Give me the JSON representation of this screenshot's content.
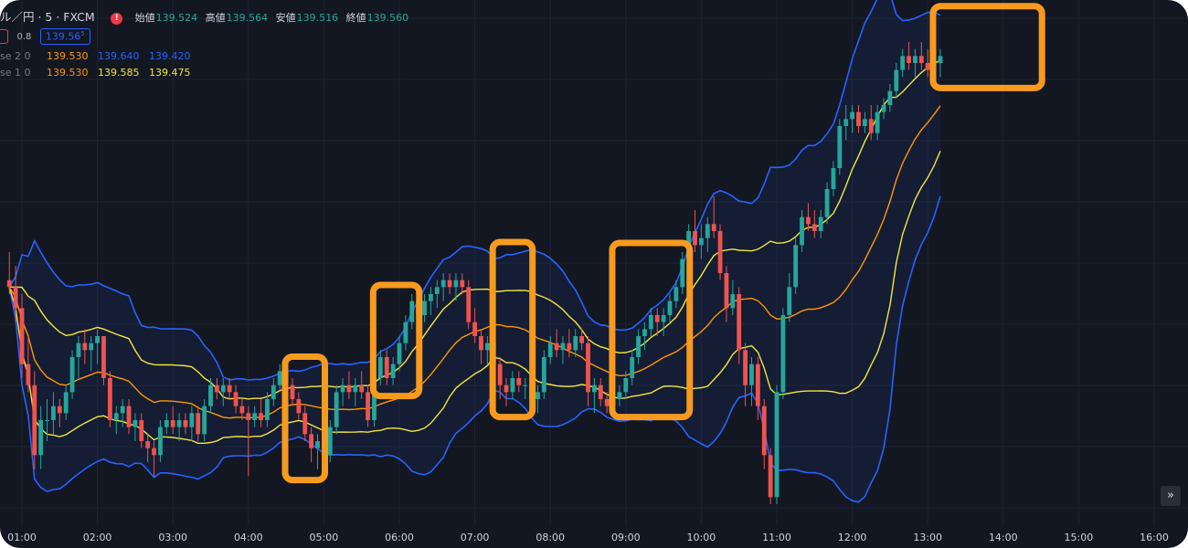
{
  "legend": {
    "symbol": "ル／円 · 5 · FXCM",
    "alert_glyph": "!",
    "ohlc": [
      {
        "label": "始値",
        "value": "139.524"
      },
      {
        "label": "高値",
        "value": "139.564"
      },
      {
        "label": "安値",
        "value": "139.516"
      },
      {
        "label": "終値",
        "value": "139.560"
      }
    ],
    "spread": "0.8",
    "price": "139.56",
    "price_sup": "5",
    "bb20": {
      "label": "se 2 0",
      "basis": "139.530",
      "upper": "139.640",
      "lower": "139.420"
    },
    "bb10": {
      "label": "se 1 0",
      "basis": "139.530",
      "upper": "139.585",
      "lower": "139.475"
    }
  },
  "scroll_glyph": "»",
  "colors": {
    "background": "#131722",
    "up": "#26a69a",
    "down": "#ef5350",
    "bb2_band": "#2962ff",
    "bb1_band": "#f5e53d",
    "basis": "#ff9800",
    "highlight": "#f79a1e"
  },
  "chart_data": {
    "type": "candlestick",
    "x_tick_labels": [
      "01:00",
      "02:00",
      "03:00",
      "04:00",
      "05:00",
      "06:00",
      "07:00",
      "08:00",
      "09:00",
      "10:00",
      "11:00",
      "12:00",
      "13:00",
      "14:00",
      "15:00",
      "16:00"
    ],
    "ylim": [
      139.35,
      140.1
    ],
    "candle_minutes": 5,
    "start_time": "00:50",
    "ohlc": [
      [
        139.7,
        139.74,
        139.68,
        139.69
      ],
      [
        139.69,
        139.72,
        139.64,
        139.66
      ],
      [
        139.66,
        139.68,
        139.56,
        139.58
      ],
      [
        139.58,
        139.62,
        139.54,
        139.55
      ],
      [
        139.55,
        139.57,
        139.43,
        139.45
      ],
      [
        139.45,
        139.52,
        139.43,
        139.5
      ],
      [
        139.5,
        139.53,
        139.47,
        139.5
      ],
      [
        139.5,
        139.54,
        139.48,
        139.52
      ],
      [
        139.52,
        139.53,
        139.49,
        139.51
      ],
      [
        139.51,
        139.55,
        139.5,
        139.54
      ],
      [
        139.54,
        139.6,
        139.53,
        139.59
      ],
      [
        139.59,
        139.62,
        139.56,
        139.61
      ],
      [
        139.61,
        139.63,
        139.58,
        139.6
      ],
      [
        139.6,
        139.62,
        139.57,
        139.61
      ],
      [
        139.61,
        139.63,
        139.58,
        139.62
      ],
      [
        139.62,
        139.62,
        139.55,
        139.56
      ],
      [
        139.56,
        139.57,
        139.49,
        139.5
      ],
      [
        139.5,
        139.52,
        139.48,
        139.51
      ],
      [
        139.51,
        139.53,
        139.49,
        139.52
      ],
      [
        139.52,
        139.53,
        139.48,
        139.49
      ],
      [
        139.49,
        139.51,
        139.47,
        139.5
      ],
      [
        139.5,
        139.51,
        139.46,
        139.47
      ],
      [
        139.47,
        139.48,
        139.44,
        139.46
      ],
      [
        139.46,
        139.47,
        139.42,
        139.45
      ],
      [
        139.45,
        139.5,
        139.44,
        139.49
      ],
      [
        139.49,
        139.51,
        139.48,
        139.5
      ],
      [
        139.5,
        139.52,
        139.48,
        139.49
      ],
      [
        139.49,
        139.51,
        139.47,
        139.5
      ],
      [
        139.5,
        139.51,
        139.48,
        139.49
      ],
      [
        139.49,
        139.52,
        139.47,
        139.51
      ],
      [
        139.51,
        139.52,
        139.47,
        139.48
      ],
      [
        139.48,
        139.53,
        139.47,
        139.52
      ],
      [
        139.52,
        139.56,
        139.51,
        139.55
      ],
      [
        139.55,
        139.56,
        139.53,
        139.54
      ],
      [
        139.54,
        139.56,
        139.52,
        139.55
      ],
      [
        139.55,
        139.56,
        139.53,
        139.54
      ],
      [
        139.54,
        139.55,
        139.51,
        139.52
      ],
      [
        139.52,
        139.53,
        139.5,
        139.51
      ],
      [
        139.51,
        139.52,
        139.42,
        139.5
      ],
      [
        139.5,
        139.52,
        139.49,
        139.51
      ],
      [
        139.51,
        139.53,
        139.49,
        139.5
      ],
      [
        139.5,
        139.54,
        139.49,
        139.53
      ],
      [
        139.53,
        139.56,
        139.52,
        139.55
      ],
      [
        139.55,
        139.58,
        139.54,
        139.57
      ],
      [
        139.57,
        139.58,
        139.54,
        139.55
      ],
      [
        139.55,
        139.56,
        139.52,
        139.53
      ],
      [
        139.53,
        139.54,
        139.5,
        139.51
      ],
      [
        139.51,
        139.52,
        139.47,
        139.48
      ],
      [
        139.48,
        139.49,
        139.44,
        139.46
      ],
      [
        139.46,
        139.48,
        139.43,
        139.47
      ],
      [
        139.47,
        139.48,
        139.44,
        139.45
      ],
      [
        139.45,
        139.5,
        139.44,
        139.49
      ],
      [
        139.49,
        139.55,
        139.48,
        139.54
      ],
      [
        139.54,
        139.56,
        139.52,
        139.55
      ],
      [
        139.55,
        139.57,
        139.53,
        139.54
      ],
      [
        139.54,
        139.56,
        139.52,
        139.55
      ],
      [
        139.55,
        139.57,
        139.53,
        139.54
      ],
      [
        139.54,
        139.55,
        139.49,
        139.5
      ],
      [
        139.5,
        139.57,
        139.49,
        139.56
      ],
      [
        139.56,
        139.6,
        139.55,
        139.59
      ],
      [
        139.59,
        139.6,
        139.55,
        139.56
      ],
      [
        139.56,
        139.59,
        139.55,
        139.58
      ],
      [
        139.58,
        139.62,
        139.57,
        139.61
      ],
      [
        139.61,
        139.65,
        139.6,
        139.64
      ],
      [
        139.64,
        139.68,
        139.63,
        139.67
      ],
      [
        139.67,
        139.68,
        139.64,
        139.65
      ],
      [
        139.65,
        139.68,
        139.64,
        139.67
      ],
      [
        139.67,
        139.69,
        139.65,
        139.68
      ],
      [
        139.68,
        139.7,
        139.66,
        139.69
      ],
      [
        139.69,
        139.71,
        139.67,
        139.7
      ],
      [
        139.7,
        139.71,
        139.68,
        139.69
      ],
      [
        139.69,
        139.71,
        139.67,
        139.7
      ],
      [
        139.7,
        139.71,
        139.68,
        139.69
      ],
      [
        139.69,
        139.7,
        139.63,
        139.64
      ],
      [
        139.64,
        139.66,
        139.61,
        139.62
      ],
      [
        139.62,
        139.63,
        139.58,
        139.6
      ],
      [
        139.6,
        139.62,
        139.58,
        139.61
      ],
      [
        139.61,
        139.62,
        139.57,
        139.58
      ],
      [
        139.58,
        139.59,
        139.53,
        139.55
      ],
      [
        139.55,
        139.56,
        139.52,
        139.54
      ],
      [
        139.54,
        139.57,
        139.53,
        139.56
      ],
      [
        139.56,
        139.57,
        139.54,
        139.55
      ],
      [
        139.55,
        139.56,
        139.53,
        139.55
      ],
      [
        139.55,
        139.56,
        139.52,
        139.53
      ],
      [
        139.53,
        139.55,
        139.51,
        139.54
      ],
      [
        139.54,
        139.6,
        139.53,
        139.59
      ],
      [
        139.59,
        139.62,
        139.58,
        139.61
      ],
      [
        139.61,
        139.63,
        139.59,
        139.6
      ],
      [
        139.6,
        139.62,
        139.58,
        139.61
      ],
      [
        139.61,
        139.63,
        139.59,
        139.6
      ],
      [
        139.6,
        139.63,
        139.59,
        139.62
      ],
      [
        139.62,
        139.63,
        139.6,
        139.61
      ],
      [
        139.61,
        139.62,
        139.52,
        139.54
      ],
      [
        139.54,
        139.56,
        139.51,
        139.55
      ],
      [
        139.55,
        139.56,
        139.52,
        139.53
      ],
      [
        139.53,
        139.54,
        139.51,
        139.52
      ],
      [
        139.52,
        139.54,
        139.51,
        139.53
      ],
      [
        139.53,
        139.55,
        139.52,
        139.54
      ],
      [
        139.54,
        139.57,
        139.53,
        139.56
      ],
      [
        139.56,
        139.6,
        139.55,
        139.59
      ],
      [
        139.59,
        139.63,
        139.58,
        139.62
      ],
      [
        139.62,
        139.64,
        139.6,
        139.63
      ],
      [
        139.63,
        139.66,
        139.62,
        139.65
      ],
      [
        139.65,
        139.66,
        139.62,
        139.64
      ],
      [
        139.64,
        139.66,
        139.62,
        139.65
      ],
      [
        139.65,
        139.68,
        139.64,
        139.67
      ],
      [
        139.67,
        139.7,
        139.66,
        139.69
      ],
      [
        139.69,
        139.74,
        139.68,
        139.73
      ],
      [
        139.73,
        139.78,
        139.72,
        139.77
      ],
      [
        139.77,
        139.8,
        139.74,
        139.75
      ],
      [
        139.75,
        139.78,
        139.73,
        139.76
      ],
      [
        139.76,
        139.79,
        139.74,
        139.78
      ],
      [
        139.78,
        139.82,
        139.76,
        139.77
      ],
      [
        139.77,
        139.78,
        139.7,
        139.71
      ],
      [
        139.71,
        139.72,
        139.64,
        139.66
      ],
      [
        139.66,
        139.7,
        139.65,
        139.68
      ],
      [
        139.68,
        139.69,
        139.58,
        139.6
      ],
      [
        139.6,
        139.61,
        139.52,
        139.55
      ],
      [
        139.55,
        139.59,
        139.52,
        139.58
      ],
      [
        139.58,
        139.59,
        139.5,
        139.52
      ],
      [
        139.52,
        139.53,
        139.43,
        139.45
      ],
      [
        139.45,
        139.46,
        139.38,
        139.39
      ],
      [
        139.39,
        139.55,
        139.38,
        139.54
      ],
      [
        139.54,
        139.66,
        139.53,
        139.65
      ],
      [
        139.65,
        139.71,
        139.64,
        139.69
      ],
      [
        139.69,
        139.76,
        139.68,
        139.75
      ],
      [
        139.75,
        139.8,
        139.74,
        139.79
      ],
      [
        139.79,
        139.81,
        139.77,
        139.78
      ],
      [
        139.78,
        139.8,
        139.76,
        139.77
      ],
      [
        139.77,
        139.8,
        139.76,
        139.79
      ],
      [
        139.79,
        139.84,
        139.78,
        139.83
      ],
      [
        139.83,
        139.87,
        139.82,
        139.86
      ],
      [
        139.86,
        139.93,
        139.85,
        139.92
      ],
      [
        139.92,
        139.95,
        139.9,
        139.93
      ],
      [
        139.93,
        139.95,
        139.91,
        139.94
      ],
      [
        139.94,
        139.95,
        139.91,
        139.92
      ],
      [
        139.92,
        139.94,
        139.91,
        139.93
      ],
      [
        139.93,
        139.95,
        139.9,
        139.91
      ],
      [
        139.91,
        139.95,
        139.9,
        139.94
      ],
      [
        139.94,
        139.96,
        139.93,
        139.95
      ],
      [
        139.95,
        139.98,
        139.94,
        139.97
      ],
      [
        139.97,
        140.01,
        139.96,
        140.0
      ],
      [
        140.0,
        140.03,
        139.99,
        140.02
      ],
      [
        140.02,
        140.04,
        140.0,
        140.01
      ],
      [
        140.01,
        140.03,
        139.99,
        140.02
      ],
      [
        140.02,
        140.04,
        140.0,
        140.01
      ],
      [
        140.01,
        140.03,
        139.99,
        140.0
      ],
      [
        140.0,
        140.02,
        139.98,
        140.01
      ],
      [
        140.01,
        140.03,
        139.99,
        140.02
      ]
    ],
    "bollinger": [
      {
        "name": "2σ",
        "period": 20,
        "basis": 139.53,
        "upper": 139.64,
        "lower": 139.42
      },
      {
        "name": "1σ",
        "period": 10,
        "basis": 139.53,
        "upper": 139.585,
        "lower": 139.475
      }
    ],
    "highlights": [
      {
        "from": "04:35",
        "to": "04:55"
      },
      {
        "from": "05:45",
        "to": "06:10"
      },
      {
        "from": "07:20",
        "to": "07:40"
      },
      {
        "from": "08:55",
        "to": "09:45"
      },
      {
        "from": "13:10",
        "to": "14:25"
      }
    ]
  }
}
